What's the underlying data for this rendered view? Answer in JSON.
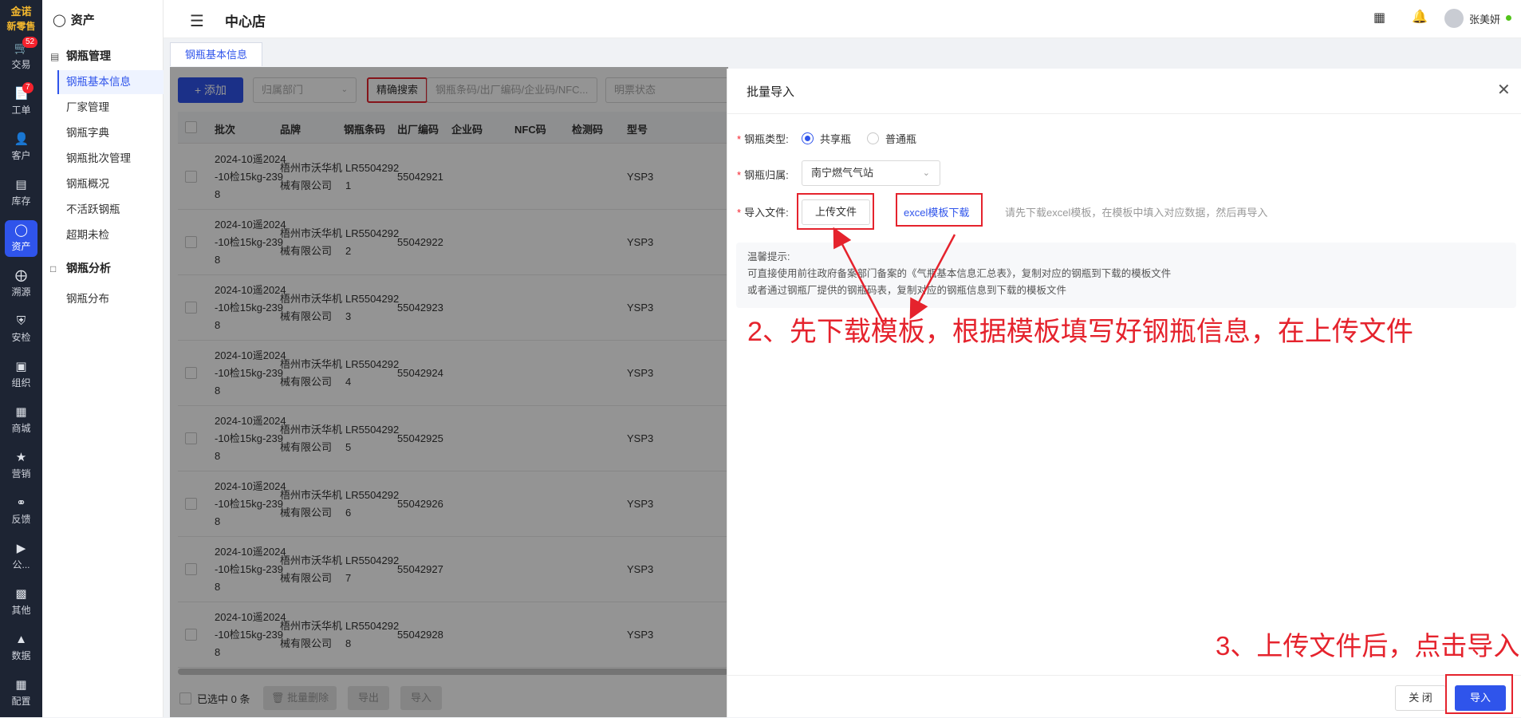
{
  "brand": {
    "line1": "金诺",
    "line2": "新零售"
  },
  "nav": [
    {
      "label": "交易",
      "icon": "trade-icon",
      "badge": "52"
    },
    {
      "label": "工单",
      "icon": "workorder-icon",
      "badge": "7"
    },
    {
      "label": "客户",
      "icon": "customer-icon",
      "badge": ""
    },
    {
      "label": "库存",
      "icon": "inventory-icon",
      "badge": ""
    },
    {
      "label": "资产",
      "icon": "bulb-icon",
      "badge": "",
      "active": true
    },
    {
      "label": "溯源",
      "icon": "compass-icon",
      "badge": ""
    },
    {
      "label": "安检",
      "icon": "shield-icon",
      "badge": ""
    },
    {
      "label": "组织",
      "icon": "org-icon",
      "badge": ""
    },
    {
      "label": "商城",
      "icon": "mall-icon",
      "badge": ""
    },
    {
      "label": "营销",
      "icon": "trophy-icon",
      "badge": ""
    },
    {
      "label": "反馈",
      "icon": "chat-icon",
      "badge": ""
    },
    {
      "label": "公...",
      "icon": "megaphone-icon",
      "badge": ""
    },
    {
      "label": "其他",
      "icon": "other-icon",
      "badge": ""
    },
    {
      "label": "数据",
      "icon": "chart-icon",
      "badge": ""
    },
    {
      "label": "配置",
      "icon": "grid-icon",
      "badge": ""
    }
  ],
  "submenu": {
    "title": "资产",
    "group1": "钢瓶管理",
    "items1": [
      "钢瓶基本信息",
      "厂家管理",
      "钢瓶字典",
      "钢瓶批次管理",
      "钢瓶概况",
      "不活跃钢瓶",
      "超期未检"
    ],
    "group2": "钢瓶分析",
    "items2": [
      "钢瓶分布"
    ]
  },
  "topbar": {
    "store": "中心店",
    "user": "张美妍"
  },
  "tab": "钢瓶基本信息",
  "toolbar": {
    "add": "添加",
    "dept_placeholder": "归属部门",
    "search_mode": "精确搜索",
    "search_placeholder": "钢瓶条码/出厂编码/企业码/NFC...",
    "status_placeholder": "明票状态"
  },
  "table": {
    "headers": [
      "批次",
      "品牌",
      "钢瓶条码",
      "出厂编码",
      "企业码",
      "NFC码",
      "检测码",
      "型号"
    ],
    "rows": [
      {
        "batch": [
          "2024-10遥2024",
          "-10检15kg-239",
          "8"
        ],
        "brand": [
          "梧州市沃华机",
          "械有限公司"
        ],
        "code": [
          "LR5504292",
          "1"
        ],
        "factory": "55042921",
        "model": "YSP3"
      },
      {
        "batch": [
          "2024-10遥2024",
          "-10检15kg-239",
          "8"
        ],
        "brand": [
          "梧州市沃华机",
          "械有限公司"
        ],
        "code": [
          "LR5504292",
          "2"
        ],
        "factory": "55042922",
        "model": "YSP3"
      },
      {
        "batch": [
          "2024-10遥2024",
          "-10检15kg-239",
          "8"
        ],
        "brand": [
          "梧州市沃华机",
          "械有限公司"
        ],
        "code": [
          "LR5504292",
          "3"
        ],
        "factory": "55042923",
        "model": "YSP3"
      },
      {
        "batch": [
          "2024-10遥2024",
          "-10检15kg-239",
          "8"
        ],
        "brand": [
          "梧州市沃华机",
          "械有限公司"
        ],
        "code": [
          "LR5504292",
          "4"
        ],
        "factory": "55042924",
        "model": "YSP3"
      },
      {
        "batch": [
          "2024-10遥2024",
          "-10检15kg-239",
          "8"
        ],
        "brand": [
          "梧州市沃华机",
          "械有限公司"
        ],
        "code": [
          "LR5504292",
          "5"
        ],
        "factory": "55042925",
        "model": "YSP3"
      },
      {
        "batch": [
          "2024-10遥2024",
          "-10检15kg-239",
          "8"
        ],
        "brand": [
          "梧州市沃华机",
          "械有限公司"
        ],
        "code": [
          "LR5504292",
          "6"
        ],
        "factory": "55042926",
        "model": "YSP3"
      },
      {
        "batch": [
          "2024-10遥2024",
          "-10检15kg-239",
          "8"
        ],
        "brand": [
          "梧州市沃华机",
          "械有限公司"
        ],
        "code": [
          "LR5504292",
          "7"
        ],
        "factory": "55042927",
        "model": "YSP3"
      },
      {
        "batch": [
          "2024-10遥2024",
          "-10检15kg-239",
          "8"
        ],
        "brand": [
          "梧州市沃华机",
          "械有限公司"
        ],
        "code": [
          "LR5504292",
          "8"
        ],
        "factory": "55042928",
        "model": "YSP3"
      }
    ]
  },
  "footer": {
    "selected": "已选中 0 条",
    "bulk_delete": "批量删除",
    "export": "导出",
    "import": "导入"
  },
  "drawer": {
    "title": "批量导入",
    "type_label": "钢瓶类型:",
    "type_options": [
      "共享瓶",
      "普通瓶"
    ],
    "owner_label": "钢瓶归属:",
    "owner_value": "南宁燃气气站",
    "file_label": "导入文件:",
    "upload": "上传文件",
    "download": "excel模板下载",
    "hint": "请先下载excel模板，在模板中填入对应数据，然后再导入",
    "tips_title": "温馨提示:",
    "tips_line1": "可直接使用前往政府备案部门备案的《气瓶基本信息汇总表》，复制对应的钢瓶到下载的模板文件",
    "tips_line2": "或者通过钢瓶厂提供的钢瓶码表，复制对应的钢瓶信息到下载的模板文件",
    "close": "关 闭",
    "import": "导入"
  },
  "annotations": {
    "step2": "2、先下载模板，根据模板填写好钢瓶信息，在上传文件",
    "step3": "3、上传文件后，点击导入"
  },
  "colors": {
    "primary": "#2f54eb",
    "nav_bg": "#1d2433",
    "annotation": "#e5232d"
  }
}
